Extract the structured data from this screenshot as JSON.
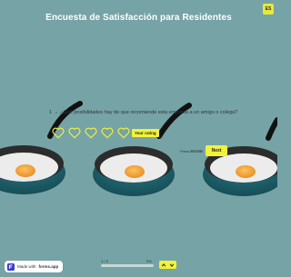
{
  "header": {
    "title": "Encuesta de Satisfacción para Residentes",
    "language_label": "ES"
  },
  "question": {
    "number": "1",
    "arrow": "→",
    "text": "¿Qué posibilidades hay de que recomiende esta empresa a un amigo o colega?",
    "rating_options": 5,
    "rating_icon": "heart-icon",
    "tooltip": "Your rating"
  },
  "actions": {
    "press_hint_prefix": "Press",
    "press_hint_key": "ENTER",
    "next_label": "Next"
  },
  "progress": {
    "label": "1 / 3",
    "percent_text": "0%",
    "value": 0
  },
  "navigation": {
    "prev_icon": "chevron-up-icon",
    "next_icon": "chevron-down-icon"
  },
  "badge": {
    "prefix": "Made with",
    "brand": "forms.app"
  },
  "colors": {
    "background": "#76a3a5",
    "accent": "#f2f23a",
    "pan": "#1f5a66",
    "egg_yolk": "#f2a23a"
  }
}
